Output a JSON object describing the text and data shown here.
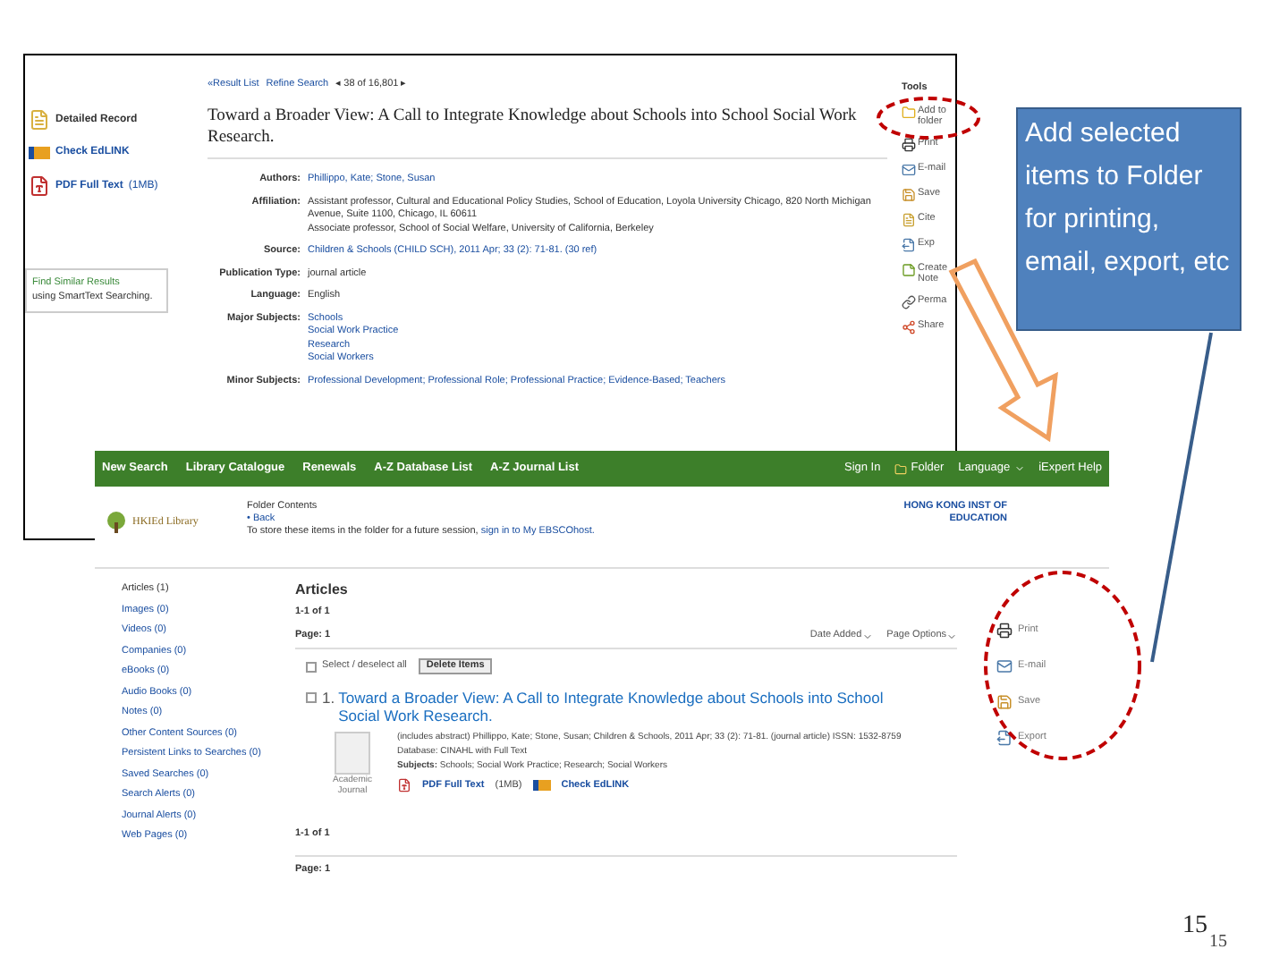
{
  "record_page": {
    "sidebar": [
      {
        "kind": "record",
        "label": "Detailed Record",
        "selected": true
      },
      {
        "kind": "edlink",
        "label": "Check EdLINK",
        "selected": false
      },
      {
        "kind": "pdf",
        "label": "PDF Full Text",
        "size": "(1MB)",
        "selected": false
      }
    ],
    "find_similar": {
      "title": "Find Similar Results",
      "subtitle": "using SmartText Searching."
    },
    "nav": {
      "back": "«Result List",
      "refine": "Refine Search",
      "position": "◂ 38 of 16,801 ▸"
    },
    "title": "Toward a Broader View: A Call to Integrate Knowledge about Schools into School Social Work Research.",
    "fields": [
      {
        "label": "Authors:",
        "kind": "link",
        "lines": [
          "Phillippo, Kate; Stone, Susan"
        ]
      },
      {
        "label": "Affiliation:",
        "kind": "text",
        "lines": [
          "Assistant professor, Cultural and Educational Policy Studies, School of Education, Loyola University Chicago, 820 North Michigan Avenue, Suite 1100, Chicago, IL 60611",
          "Associate professor, School of Social Welfare, University of California, Berkeley"
        ]
      },
      {
        "label": "Source:",
        "kind": "link",
        "lines": [
          "Children & Schools (CHILD SCH), 2011 Apr; 33 (2): 71-81. (30 ref)"
        ]
      },
      {
        "label": "Publication Type:",
        "kind": "text",
        "lines": [
          "journal article"
        ]
      },
      {
        "label": "Language:",
        "kind": "text",
        "lines": [
          "English"
        ]
      },
      {
        "label": "Major Subjects:",
        "kind": "link",
        "lines": [
          "Schools",
          "Social Work Practice",
          "Research",
          "Social Workers"
        ]
      },
      {
        "label": "Minor Subjects:",
        "kind": "link",
        "lines": [
          "Professional Development; Professional Role; Professional Practice; Evidence-Based; Teachers"
        ]
      }
    ],
    "tools": {
      "heading": "Tools",
      "items": [
        {
          "kind": "folder",
          "label": "Add to folder"
        },
        {
          "kind": "printer",
          "label": "Print"
        },
        {
          "kind": "mail",
          "label": "E-mail"
        },
        {
          "kind": "save",
          "label": "Save"
        },
        {
          "kind": "cite",
          "label": "Cite"
        },
        {
          "kind": "export",
          "label": "Exp"
        },
        {
          "kind": "note",
          "label": "Create Note"
        },
        {
          "kind": "link",
          "label": "Perma"
        },
        {
          "kind": "share",
          "label": "Share"
        }
      ]
    }
  },
  "folder_page": {
    "menu": [
      "New Search",
      "Library Catalogue",
      "Renewals",
      "A-Z Database List",
      "A-Z Journal List"
    ],
    "menu_right": [
      {
        "kind": "text",
        "label": "Sign In"
      },
      {
        "kind": "folder",
        "label": "Folder"
      },
      {
        "kind": "dropdown",
        "label": "Language"
      },
      {
        "kind": "text",
        "label": "iExpert Help"
      }
    ],
    "logo": "HKIEd Library",
    "heading": "Folder Contents",
    "back": "• Back",
    "note": "To store these items in the folder for a future session, ",
    "note_link": "sign in to My EBSCOhost.",
    "institution": "HONG KONG INST OF EDUCATION",
    "categories": [
      {
        "label": "Articles (1)",
        "selected": true
      },
      {
        "label": "Images (0)",
        "selected": false
      },
      {
        "label": "Videos (0)",
        "selected": false
      },
      {
        "label": "Companies (0)",
        "selected": false
      },
      {
        "label": "eBooks (0)",
        "selected": false
      },
      {
        "label": "Audio Books (0)",
        "selected": false
      },
      {
        "label": "Notes (0)",
        "selected": false
      },
      {
        "label": "Other Content Sources (0)",
        "selected": false
      },
      {
        "label": "Persistent Links to Searches (0)",
        "selected": false
      },
      {
        "label": "Saved Searches (0)",
        "selected": false
      },
      {
        "label": "Search Alerts (0)",
        "selected": false
      },
      {
        "label": "Journal Alerts (0)",
        "selected": false
      },
      {
        "label": "Web Pages (0)",
        "selected": false
      }
    ],
    "section": "Articles",
    "count": "1-1 of 1",
    "page": "Page: 1",
    "sort": "Date Added",
    "options": "Page Options",
    "select_all": {
      "label": "Select / deselect all",
      "checked": false
    },
    "delete": "Delete Items",
    "result": {
      "number": "1.",
      "title": "Toward a Broader View: A Call to Integrate Knowledge about Schools into School Social Work Research.",
      "checked": false,
      "type": "Academic Journal",
      "details": "(includes abstract) Phillippo, Kate; Stone, Susan; Children & Schools, 2011 Apr; 33 (2): 71-81. (journal article) ISSN: 1532-8759",
      "database": "Database: CINAHL with Full Text",
      "subjects": "**Subjects:** Schools; Social Work Practice; Research; Social Workers",
      "pdf": "PDF Full Text",
      "pdf_size": "(1MB)",
      "edlink": "Check EdLINK"
    },
    "count_bottom": "1-1 of 1",
    "page_bottom": "Page: 1",
    "tools": [
      {
        "kind": "printer",
        "label": "Print"
      },
      {
        "kind": "mail",
        "label": "E-mail"
      },
      {
        "kind": "save",
        "label": "Save"
      },
      {
        "kind": "export",
        "label": "Export"
      }
    ]
  },
  "callout": "Add selected items to Folder for printing, email, export, etc",
  "slide_number": "15",
  "slide_number_small": "15"
}
